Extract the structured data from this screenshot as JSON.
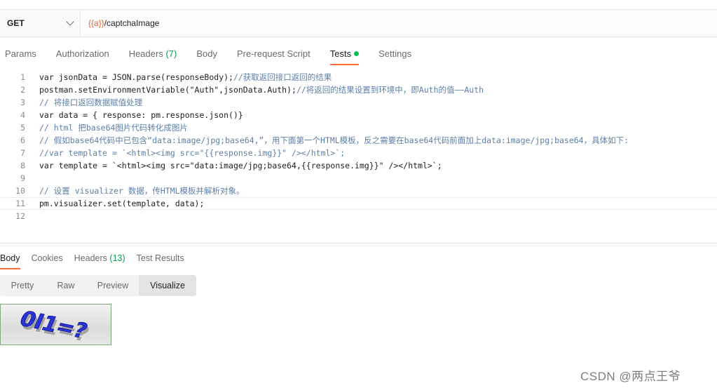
{
  "request": {
    "method": "GET",
    "url_var": "{{a}}",
    "url_path": "/captchaImage"
  },
  "request_tabs": [
    {
      "label": "Params",
      "count": ""
    },
    {
      "label": "Authorization",
      "count": ""
    },
    {
      "label": "Headers",
      "count": "(7)"
    },
    {
      "label": "Body",
      "count": ""
    },
    {
      "label": "Pre-request Script",
      "count": ""
    },
    {
      "label": "Tests",
      "count": ""
    },
    {
      "label": "Settings",
      "count": ""
    }
  ],
  "editor": {
    "lines": [
      {
        "n": "1",
        "a": "var jsonData = JSON.parse(responseBody);",
        "b": "//获取返回接口返回的结果"
      },
      {
        "n": "2",
        "a": "postman.setEnvironmentVariable(\"Auth\",jsonData.Auth);",
        "b": "//将返回的结果设置到环境中，即Auth的值——Auth"
      },
      {
        "n": "3",
        "a": "",
        "b": "// 将接口返回数据赋值处理"
      },
      {
        "n": "4",
        "a": "var data = { response: pm.response.json()}",
        "b": ""
      },
      {
        "n": "5",
        "a": "",
        "b": "// html 把base64图片代码转化成图片"
      },
      {
        "n": "6",
        "a": "",
        "b": "// 假如base64代码中已包含“data:image/jpg;base64,”，用下面第一个HTML模板，反之需要在base64代码前面加上data:image/jpg;base64，具体如下:"
      },
      {
        "n": "7",
        "a": "",
        "b": "//var template = `<html><img src=\"{{response.img}}\" /></html>`;"
      },
      {
        "n": "8",
        "a": "var template = `<html><img src=\"data:image/jpg;base64,{{response.img}}\" /></html>`;",
        "b": ""
      },
      {
        "n": "9",
        "a": "",
        "b": ""
      },
      {
        "n": "10",
        "a": "",
        "b": "// 设置 visualizer 数据，传HTML模板并解析对象。"
      },
      {
        "n": "11",
        "a": "pm.visualizer.set(template, data);",
        "b": ""
      },
      {
        "n": "12",
        "a": "",
        "b": ""
      }
    ]
  },
  "response_tabs": [
    {
      "label": "Body",
      "count": ""
    },
    {
      "label": "Cookies",
      "count": ""
    },
    {
      "label": "Headers",
      "count": "(13)"
    },
    {
      "label": "Test Results",
      "count": ""
    }
  ],
  "view_modes": [
    "Pretty",
    "Raw",
    "Preview",
    "Visualize"
  ],
  "captcha_text": "0I1=?",
  "watermark": "CSDN @两点王爷",
  "colors": {
    "accent": "#ff6c37",
    "status_green": "#0cbb52",
    "url_var": "#e0663c",
    "comment": "#5c7fa8"
  }
}
